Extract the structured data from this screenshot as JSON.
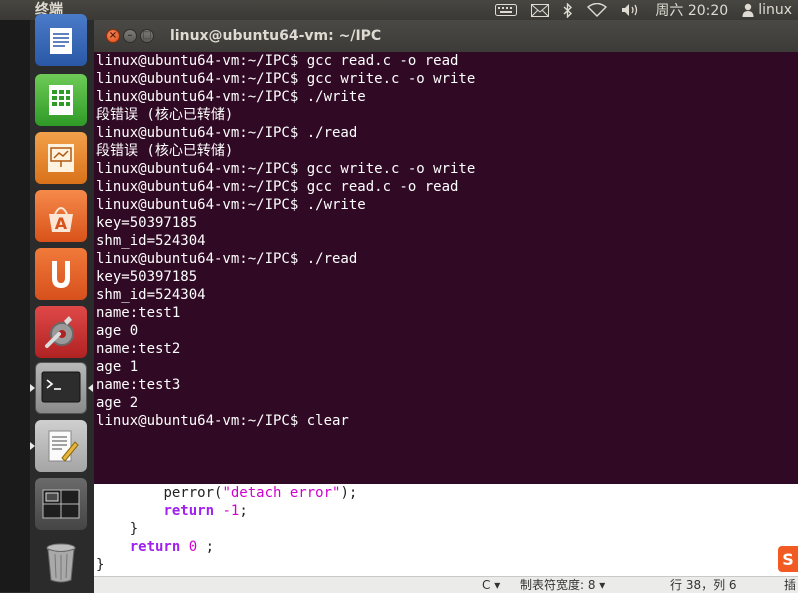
{
  "top_panel": {
    "app_title": "终端",
    "indicators": {
      "keyboard_icon": "keyboard-icon",
      "mail_icon": "mail-icon",
      "bluetooth_icon": "bluetooth-icon",
      "wifi_icon": "wifi-icon",
      "volume_icon": "volume-icon",
      "clock": "周六 20:20",
      "user": "linux"
    }
  },
  "launcher": {
    "items": [
      {
        "name": "libreoffice-writer-icon"
      },
      {
        "name": "libreoffice-calc-icon"
      },
      {
        "name": "libreoffice-impress-icon"
      },
      {
        "name": "ubuntu-software-center-icon"
      },
      {
        "name": "ubuntu-one-icon"
      },
      {
        "name": "system-settings-icon"
      },
      {
        "name": "terminal-icon"
      },
      {
        "name": "text-editor-icon"
      },
      {
        "name": "workspace-switcher-icon"
      },
      {
        "name": "trash-icon"
      }
    ]
  },
  "terminal": {
    "title": "linux@ubuntu64-vm: ~/IPC",
    "lines": [
      "linux@ubuntu64-vm:~/IPC$ gcc read.c -o read",
      "linux@ubuntu64-vm:~/IPC$ gcc write.c -o write",
      "linux@ubuntu64-vm:~/IPC$ ./write",
      "段错误 (核心已转储)",
      "linux@ubuntu64-vm:~/IPC$ ./read",
      "段错误 (核心已转储)",
      "linux@ubuntu64-vm:~/IPC$ gcc write.c -o write",
      "linux@ubuntu64-vm:~/IPC$ gcc read.c -o read",
      "linux@ubuntu64-vm:~/IPC$ ./write",
      "key=50397185",
      "shm_id=524304",
      "linux@ubuntu64-vm:~/IPC$ ./read",
      "key=50397185",
      "shm_id=524304",
      "name:test1",
      "age 0",
      "name:test2",
      "age 1",
      "name:test3",
      "age 2",
      "linux@ubuntu64-vm:~/IPC$ clear"
    ]
  },
  "editor": {
    "code": {
      "l1_indent": "        ",
      "l1_fn": "perror(",
      "l1_str": "\"detach error\"",
      "l1_end": ");",
      "l2_indent": "        ",
      "l2_kw": "return",
      "l2_val": " -1",
      "l2_end": ";",
      "l3": "    }",
      "l4_indent": "    ",
      "l4_kw": "return",
      "l4_val": " 0",
      "l4_end": " ;",
      "l5": "}"
    },
    "status": {
      "lang": "C ▾",
      "tab_width": "制表符宽度: 8 ▾",
      "line": "行 38，列 6",
      "ins": "插"
    }
  }
}
